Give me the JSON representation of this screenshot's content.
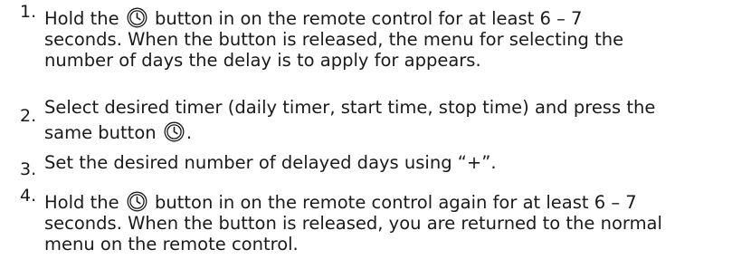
{
  "steps": [
    {
      "number": "1.",
      "line1_before_icon": "Hold the ",
      "icon": "timer-clock-icon",
      "line1_after_icon": " button in on the remote control for at least 6 – 7",
      "line2": "seconds. When the button is released, the menu for selecting the",
      "line3": "number of days the delay is to apply for appears."
    },
    {
      "number": "2.",
      "line1": "Select desired timer (daily timer, start time, stop time) and press the",
      "line2_before_icon": "same button ",
      "icon": "timer-clock-icon",
      "line2_after_icon": "."
    },
    {
      "number": "3.",
      "line1": "Set the desired number of delayed days using “+”."
    },
    {
      "number": "4.",
      "line1_before_icon": "Hold the ",
      "icon": "timer-clock-icon",
      "line1_after_icon": " button in on the remote control again for at least 6 – 7",
      "line2": "seconds. When the button is released, you are returned to the normal",
      "line3": "menu on the remote control."
    }
  ]
}
